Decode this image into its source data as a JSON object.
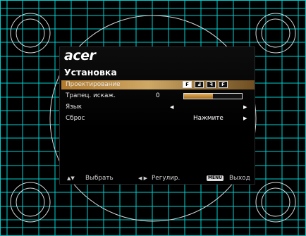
{
  "osd": {
    "logo": "acer",
    "title": "Установка",
    "items": [
      {
        "label": "Проектирование"
      },
      {
        "label": "Трапец. искаж.",
        "value": "0",
        "bar_fraction": 0.5
      },
      {
        "label": "Язык",
        "left_arrow": "◀",
        "right_arrow": "▶"
      },
      {
        "label": "Сброс",
        "value": "Нажмите",
        "right_arrow": "▶"
      }
    ],
    "projection_icons": [
      {
        "glyph": "F",
        "name": "front-projection-icon"
      },
      {
        "glyph": "Ⅎ",
        "name": "rear-projection-icon"
      },
      {
        "glyph": "ꟻ",
        "name": "front-ceiling-projection-icon"
      },
      {
        "glyph": "F",
        "name": "rear-ceiling-projection-icon"
      }
    ],
    "footer": {
      "select_arrows": "▲▼",
      "select_label": "Выбрать",
      "adjust_arrows": "◀ ▶",
      "adjust_label": "Регулир.",
      "menu_key": "MENU",
      "exit_label": "Выход"
    }
  },
  "colors": {
    "grid": "#00d0d0",
    "selected_bar": "#cfa865",
    "background": "#000000"
  }
}
